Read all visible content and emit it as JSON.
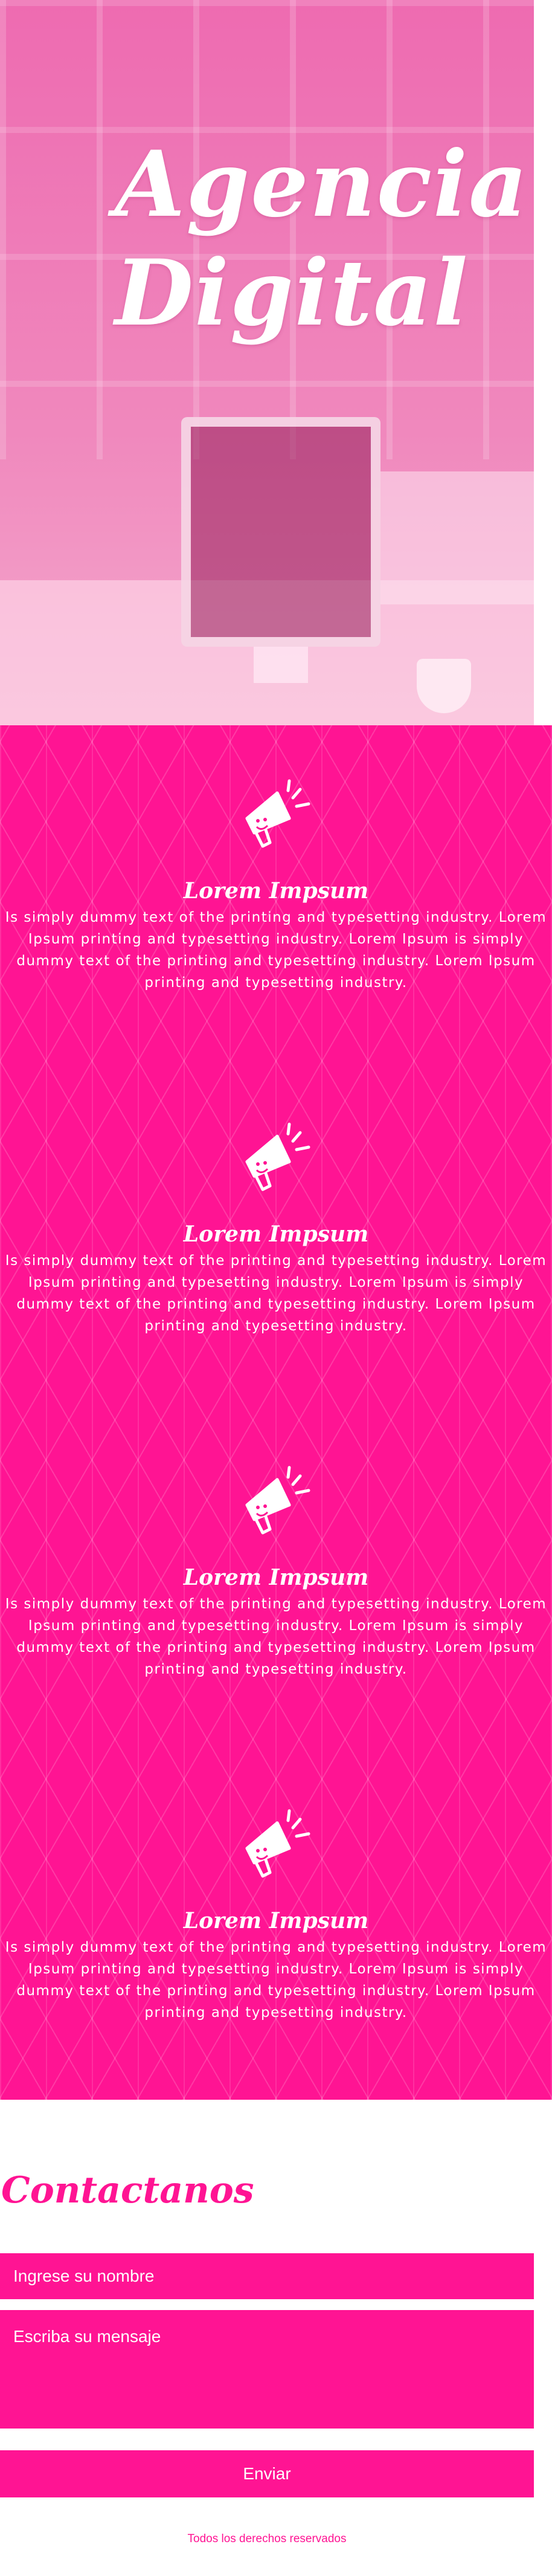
{
  "hero": {
    "title_line1": "Agencia",
    "title_line2": "Digital"
  },
  "features": [
    {
      "icon": "megaphone-icon",
      "title": "Lorem Impsum",
      "text": "Is simply dummy text of the printing and typesetting industry. Lorem Ipsum printing and typesetting industry. Lorem Ipsum is simply dummy text of the printing and typesetting industry. Lorem Ipsum printing and typesetting industry."
    },
    {
      "icon": "megaphone-icon",
      "title": "Lorem Impsum",
      "text": "Is simply dummy text of the printing and typesetting industry. Lorem Ipsum printing and typesetting industry. Lorem Ipsum is simply dummy text of the printing and typesetting industry. Lorem Ipsum printing and typesetting industry."
    },
    {
      "icon": "megaphone-icon",
      "title": "Lorem Impsum",
      "text": "Is simply dummy text of the printing and typesetting industry. Lorem Ipsum printing and typesetting industry. Lorem Ipsum is simply dummy text of the printing and typesetting industry. Lorem Ipsum printing and typesetting industry."
    },
    {
      "icon": "megaphone-icon",
      "title": "Lorem Impsum",
      "text": "Is simply dummy text of the printing and typesetting industry. Lorem Ipsum printing and typesetting industry. Lorem Ipsum is simply dummy text of the printing and typesetting industry. Lorem Ipsum printing and typesetting industry."
    }
  ],
  "contact": {
    "title": "Contactanos",
    "name_placeholder": "Ingrese su nombre",
    "message_placeholder": "Escriba su mensaje",
    "submit_label": "Enviar"
  },
  "footer": {
    "text": "Todos los derechos reservados"
  },
  "colors": {
    "accent": "#ff1493",
    "text_light": "#ffffff"
  }
}
